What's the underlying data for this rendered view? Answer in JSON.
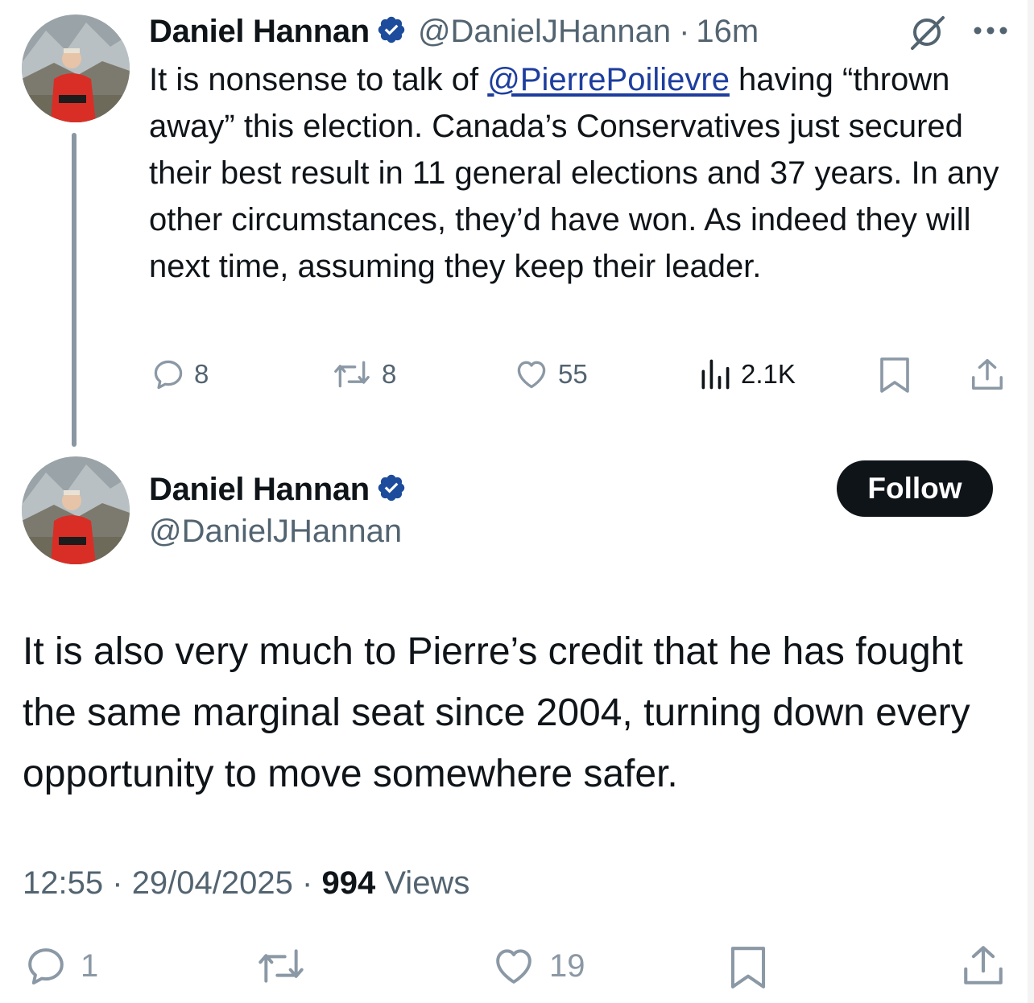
{
  "reply_to": {
    "author_name": "Daniel Hannan",
    "handle": "@DanielJHannan",
    "separator": "·",
    "time_ago": "16m",
    "text_before": "It is nonsense to talk of ",
    "mention": "@PierrePoilievre",
    "text_after": " having “thrown away” this election. Canada’s Conservatives just secured their best result in 11 general elections and 37 years. In any other circumstances, they’d have won. As indeed they will next time, assuming they keep their leader.",
    "replies": "8",
    "reposts": "8",
    "likes": "55",
    "views": "2.1K"
  },
  "main_tweet": {
    "author_name": "Daniel Hannan",
    "handle": "@DanielJHannan",
    "follow_label": "Follow",
    "text": "It is also very much to Pierre’s credit that he has fought the same marginal seat since 2004, turning down every opportunity to move somewhere safer.",
    "time": "12:55",
    "date": "29/04/2025",
    "sep1": "·",
    "sep2": "·",
    "views_count": "994",
    "views_label": "Views",
    "replies": "1",
    "likes": "19"
  },
  "colors": {
    "text": "#0f1419",
    "secondary": "#536471",
    "verified": "#1d4c9c",
    "mention": "#1d3e9e",
    "follow_bg": "#0f1419"
  },
  "icons": [
    "verified-badge-icon",
    "grok-icon",
    "more-icon",
    "reply-icon",
    "repost-icon",
    "like-icon",
    "views-icon",
    "bookmark-icon",
    "share-icon"
  ]
}
